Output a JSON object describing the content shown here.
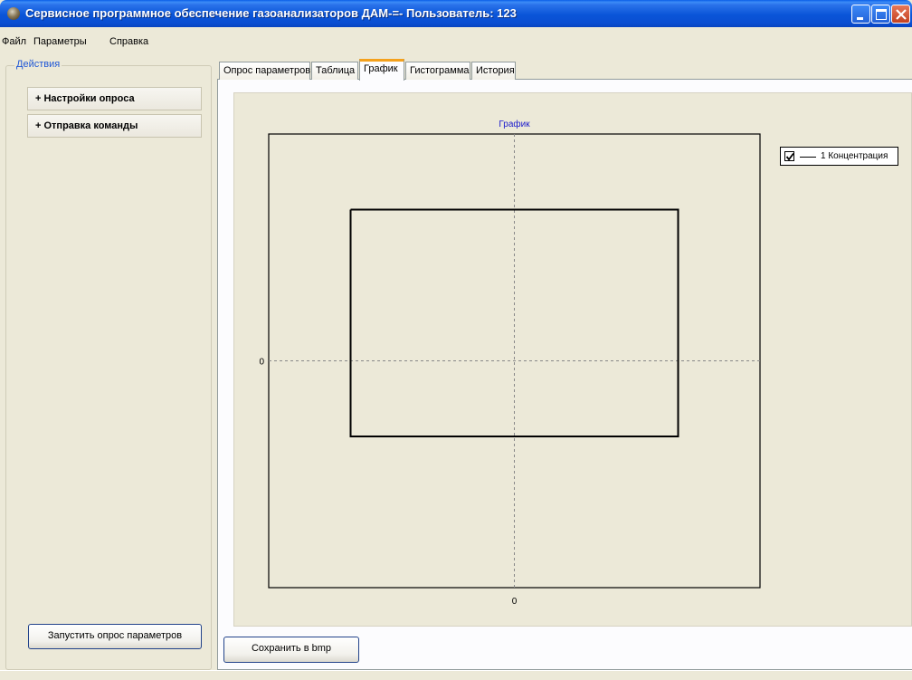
{
  "window": {
    "title": "Сервисное программное обеспечение газоанализаторов ДАМ-=- Пользователь: 123"
  },
  "menu": {
    "items": [
      "Файл",
      "Параметры",
      "Справка"
    ]
  },
  "actions": {
    "group_title": "Действия",
    "items": [
      "+ Настройки опроса",
      "+ Отправка команды"
    ],
    "start_button": "Запустить опрос параметров"
  },
  "tabs": [
    {
      "label": "Опрос параметров",
      "active": false
    },
    {
      "label": "Таблица",
      "active": false
    },
    {
      "label": "График",
      "active": true
    },
    {
      "label": "Гистограмма",
      "active": false
    },
    {
      "label": "История",
      "active": false
    }
  ],
  "save_button": "Сохранить в bmp",
  "colors": {
    "title_text": "#1a1acc",
    "accent": "#f4a11c"
  },
  "chart_data": {
    "type": "line",
    "title": "График",
    "xlabel": "",
    "ylabel": "",
    "x_ticks": [
      "0"
    ],
    "y_ticks": [
      "0"
    ],
    "grid": "dashed zero lines",
    "legend": {
      "placement": "top-right",
      "entries": [
        {
          "label": "1 Концентрация",
          "checked": true
        }
      ]
    },
    "series": [
      {
        "name": "1 Концентрация",
        "color": "#000000",
        "x": [
          -1,
          1,
          1,
          -1,
          -1
        ],
        "y": [
          1,
          1,
          -0.5,
          -0.5,
          1
        ]
      }
    ],
    "xlim": [
      -1.5,
      1.5
    ],
    "ylim": [
      -1.5,
      1.5
    ]
  }
}
